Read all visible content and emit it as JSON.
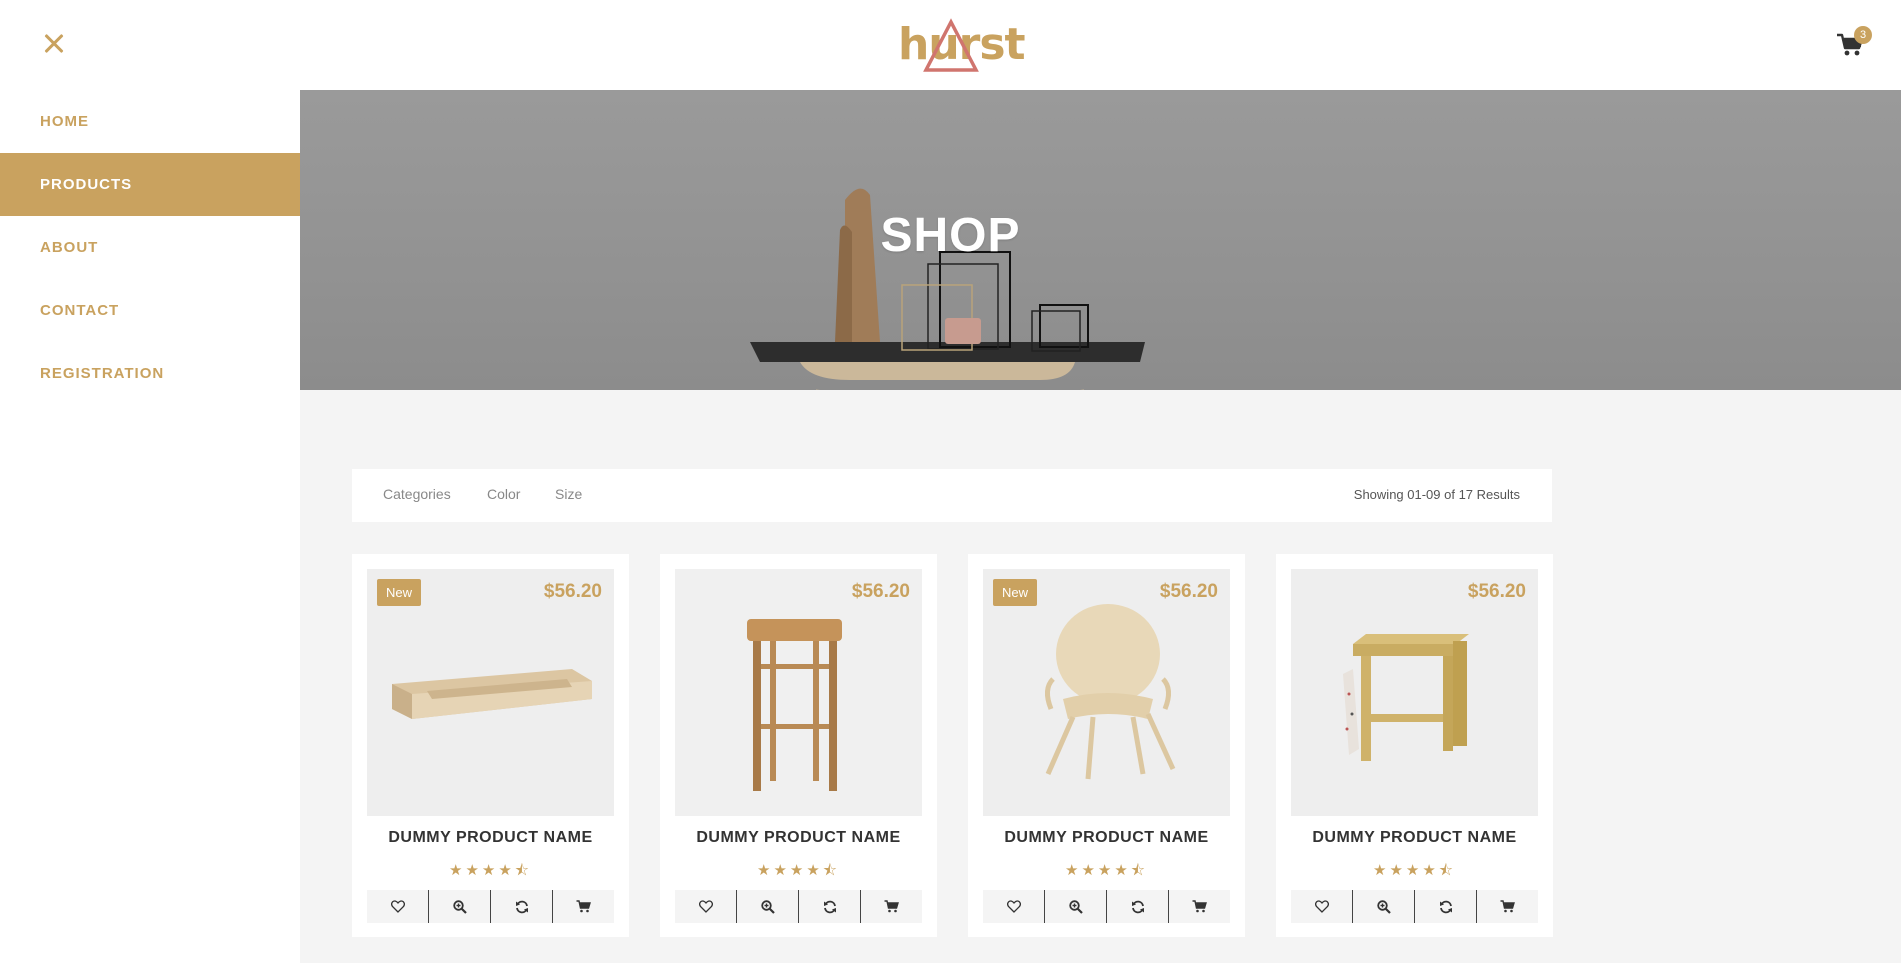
{
  "header": {
    "logo_text": "hurst",
    "cart_count": "3",
    "close_icon": "close-icon",
    "cart_icon": "cart-icon"
  },
  "sidebar": {
    "items": [
      {
        "label": "HOME",
        "active": false
      },
      {
        "label": "PRODUCTS",
        "active": true
      },
      {
        "label": "ABOUT",
        "active": false
      },
      {
        "label": "CONTACT",
        "active": false
      },
      {
        "label": "REGISTRATION",
        "active": false
      }
    ]
  },
  "hero": {
    "title": "SHOP"
  },
  "filters": {
    "items": [
      "Categories",
      "Color",
      "Size"
    ],
    "results_text": "Showing 01-09 of 17 Results"
  },
  "products": [
    {
      "name": "DUMMY PRODUCT NAME",
      "price": "$56.20",
      "badge": "New",
      "rating": 4.5,
      "image": "wooden-tray"
    },
    {
      "name": "DUMMY PRODUCT NAME",
      "price": "$56.20",
      "badge": "",
      "rating": 4.5,
      "image": "bar-stool"
    },
    {
      "name": "DUMMY PRODUCT NAME",
      "price": "$56.20",
      "badge": "New",
      "rating": 4.5,
      "image": "armchair"
    },
    {
      "name": "DUMMY PRODUCT NAME",
      "price": "$56.20",
      "badge": "",
      "rating": 4.5,
      "image": "side-table"
    }
  ],
  "product_actions": [
    "heart-icon",
    "zoom-icon",
    "refresh-icon",
    "cart-icon"
  ],
  "colors": {
    "accent": "#c9a25f",
    "background": "#f4f4f4",
    "text": "#333333"
  }
}
